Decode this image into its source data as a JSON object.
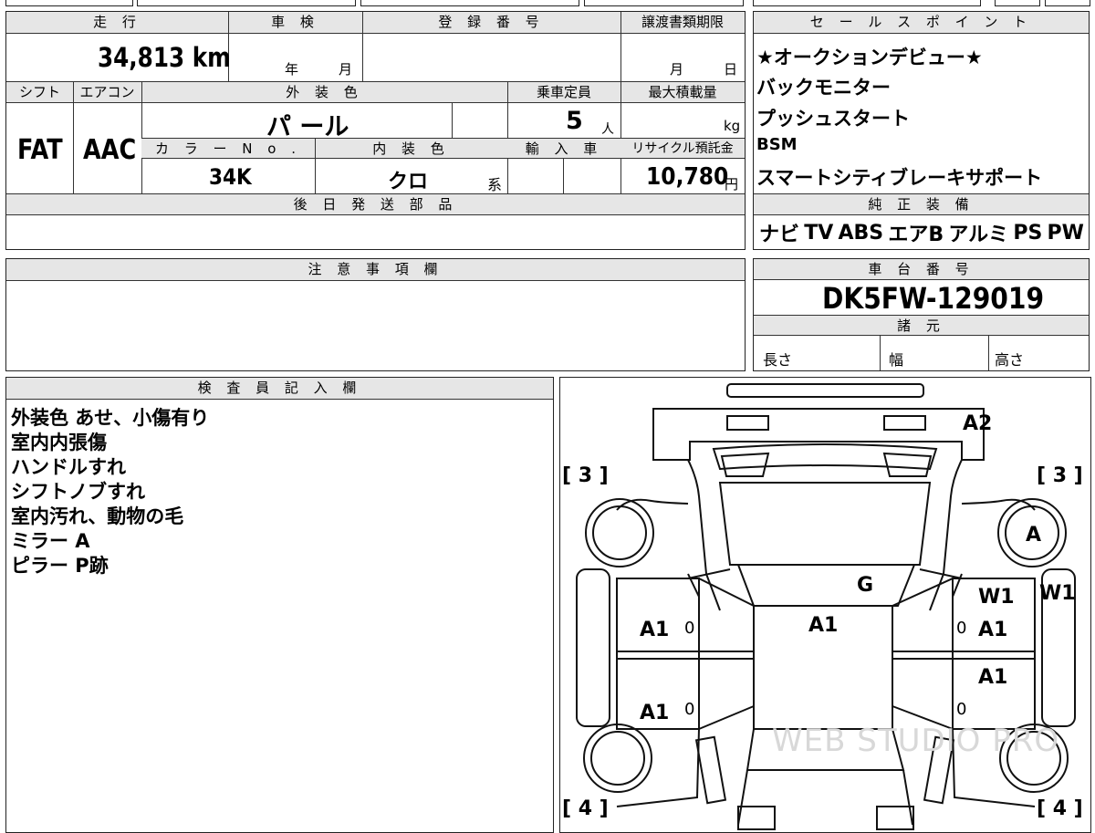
{
  "vehicle": {
    "mileage_header": "走 行",
    "mileage_value": "34,813 km",
    "inspection_header": "車 検",
    "inspection_year": "年",
    "inspection_month": "月",
    "registration_header": "登 録 番 号",
    "registration_value": "",
    "transfer_header": "譲渡書類期限",
    "transfer_month": "月",
    "transfer_day": "日",
    "shift_header": "シフト",
    "shift_value": "FAT",
    "ac_header": "エアコン",
    "ac_value": "AAC",
    "exterior_color_header": "外 装 色",
    "exterior_color_value": "パ ール",
    "capacity_header": "乗車定員",
    "capacity_value": "5",
    "capacity_unit": "人",
    "max_load_header": "最大積載量",
    "max_load_unit": "kg",
    "color_no_header": "カ ラ ー N o .",
    "color_no_value": "34K",
    "interior_color_header": "内 装 色",
    "interior_color_value": "クロ",
    "interior_color_suffix": "系",
    "import_header": "輸 入 車",
    "recycle_header": "リサイクル預託金",
    "recycle_value": "10,780",
    "recycle_unit": "円",
    "later_parts_header": "後 日 発 送 部 品"
  },
  "sales_points": {
    "header": "セ ー ル ス ポ イ ン ト",
    "items": [
      "★オークションデビュー★",
      "バックモニター",
      "プッシュスタート",
      "BSM",
      "スマートシティブレーキサポート"
    ]
  },
  "genuine_equipment": {
    "header": "純 正 装 備",
    "items": [
      "ナビ",
      "TV",
      "ABS",
      "エアB",
      "アルミ",
      "PS",
      "PW"
    ]
  },
  "caution": {
    "header": "注 意 事 項 欄"
  },
  "chassis": {
    "header": "車 台 番 号",
    "value": "DK5FW-129019"
  },
  "specs": {
    "header": "諸 元",
    "length_label": "長さ",
    "width_label": "幅",
    "height_label": "高さ"
  },
  "inspector": {
    "header": "検 査 員 記 入 欄",
    "notes": [
      "外装色 あせ、小傷有り",
      "室内内張傷",
      "ハンドルすれ",
      "シフトノブすれ",
      "室内汚れ、動物の毛",
      "ミラー A",
      "ピラー P跡"
    ]
  },
  "diagram": {
    "tire_front_left": "[ 3 ]",
    "tire_front_right": "[ 3 ]",
    "tire_rear_left": "[ 4 ]",
    "tire_rear_right": "[ 4 ]",
    "marks": {
      "front_bumper": "A2",
      "right_mirror": "A",
      "windshield": "G",
      "right_front_door_upper": "W1",
      "right_side_edge": "W1",
      "left_front_door": "A1",
      "roof": "A1",
      "right_front_door": "A1",
      "right_rear_door": "A1",
      "left_rear_door": "A1"
    },
    "zeros": [
      "0",
      "0",
      "0",
      "0"
    ],
    "watermark": "WEB STUDIO PRO"
  }
}
